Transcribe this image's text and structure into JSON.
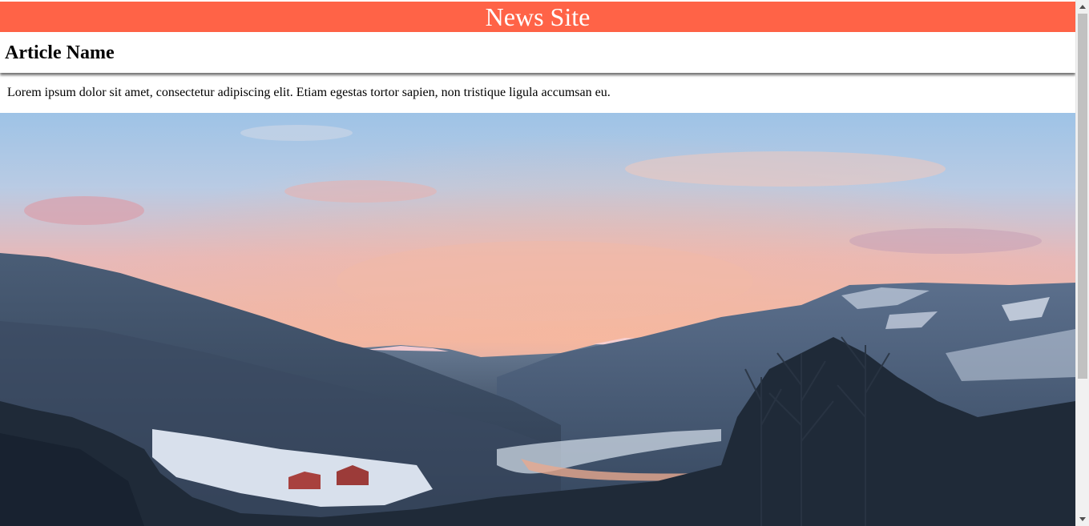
{
  "header": {
    "site_title": "News Site",
    "bg_color": "#ff6347"
  },
  "article": {
    "title": "Article Name",
    "body": "Lorem ipsum dolor sit amet, consectetur adipiscing elit. Etiam egestas tortor sapien, non tristique ligula accumsan eu."
  },
  "image": {
    "subject": "snowy mountain valley at dusk with pink clouds"
  },
  "scrollbar": {
    "up_icon": "triangle-up-icon",
    "down_icon": "triangle-down-icon"
  }
}
